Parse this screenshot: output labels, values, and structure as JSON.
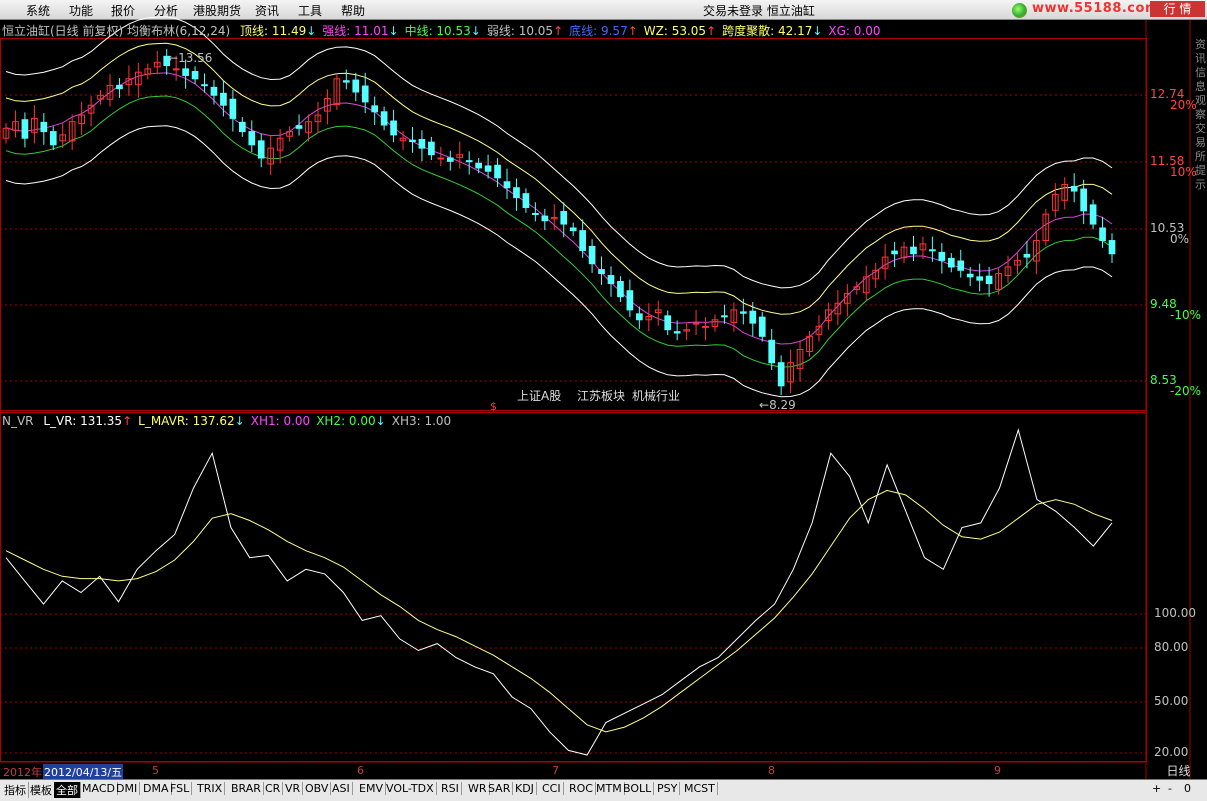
{
  "menu": {
    "items": [
      "系统",
      "功能",
      "报价",
      "分析",
      "港股期货",
      "资讯",
      "工具",
      "帮助"
    ],
    "status": "交易未登录",
    "stock": "恒立油缸",
    "url": "www.55188.com",
    "quote_btn": "行 情"
  },
  "main_info": {
    "title": "恒立油缸(日线 前复权) 均衡布林(6,12,24)",
    "items": [
      {
        "label": "顶线: 11.49",
        "arrow": "↓",
        "color": "#ffff66"
      },
      {
        "label": "强线: 11.01",
        "arrow": "↓",
        "color": "#ff44ff"
      },
      {
        "label": "中线: 10.53",
        "arrow": "↓",
        "color": "#44ff44"
      },
      {
        "label": "弱线: 10.05",
        "arrow": "↑",
        "color": "#c0c0c0"
      },
      {
        "label": "底线: 9.57",
        "arrow": "↑",
        "color": "#4466ff"
      },
      {
        "label": "WZ: 53.05",
        "arrow": "↑",
        "color": "#ffff66"
      },
      {
        "label": "跨度聚散: 42.17",
        "arrow": "↓",
        "color": "#ffff66"
      },
      {
        "label": "XG: 0.00",
        "arrow": "",
        "color": "#ff44ff"
      }
    ]
  },
  "price_axis": [
    {
      "price": "12.74",
      "pct": "20%"
    },
    {
      "price": "11.58",
      "pct": "10%"
    },
    {
      "price": "10.53",
      "pct": "0%"
    },
    {
      "price": "9.48",
      "pct": "-10%"
    },
    {
      "price": "8.53",
      "pct": "-20%"
    }
  ],
  "annotations": {
    "high": "13.56",
    "low": "8.29",
    "marker": "$"
  },
  "sectors": [
    "上证A股",
    "江苏板块",
    "机械行业"
  ],
  "sub_info": {
    "title": "N_VR",
    "items": [
      {
        "label": "L_VR: 131.35",
        "arrow": "↑",
        "color": "#ffffff"
      },
      {
        "label": "L_MAVR: 137.62",
        "arrow": "↓",
        "color": "#ffff66"
      },
      {
        "label": "XH1: 0.00",
        "arrow": "",
        "color": "#ff44ff"
      },
      {
        "label": "XH2: 0.00",
        "arrow": "↓",
        "color": "#44ff44"
      },
      {
        "label": "XH3: 1.00",
        "arrow": "",
        "color": "#c0c0c0"
      }
    ]
  },
  "sub_axis": [
    "100.00",
    "80.00",
    "50.00",
    "20.00"
  ],
  "dates": {
    "year": "2012年",
    "cursor": "2012/04/13/五",
    "months": [
      "5",
      "6",
      "7",
      "8",
      "9"
    ]
  },
  "daily_label": "日线",
  "tabs": [
    "指标",
    "模板",
    "全部",
    "MACD",
    "DMI",
    "DMA",
    "FSL",
    "TRIX",
    "BRAR",
    "CR",
    "VR",
    "OBV",
    "ASI",
    "EMV",
    "VOL-TDX",
    "RSI",
    "WR",
    "SAR",
    "KDJ",
    "CCI",
    "ROC",
    "MTM",
    "BOLL",
    "PSY",
    "MCST"
  ],
  "right_strip": "资讯信息观察交易所提示",
  "chart_data": [
    {
      "type": "candlestick",
      "title": "恒立油缸(日线 前复权) 均衡布林(6,12,24)",
      "ylim": [
        8.29,
        13.56
      ],
      "close": [
        12.45,
        12.55,
        12.3,
        12.6,
        12.4,
        12.2,
        12.35,
        12.55,
        12.65,
        12.8,
        12.95,
        13.1,
        13.05,
        13.2,
        13.3,
        13.35,
        13.45,
        13.4,
        13.35,
        13.25,
        13.2,
        13.1,
        12.95,
        12.8,
        12.6,
        12.4,
        12.2,
        12.0,
        12.15,
        12.3,
        12.4,
        12.45,
        12.55,
        12.65,
        12.9,
        13.2,
        13.15,
        13.0,
        12.85,
        12.7,
        12.5,
        12.35,
        12.3,
        12.25,
        12.15,
        12.05,
        12.0,
        11.95,
        12.05,
        11.95,
        11.85,
        11.8,
        11.7,
        11.55,
        11.4,
        11.25,
        11.15,
        11.05,
        11.1,
        11.0,
        10.9,
        10.6,
        10.4,
        10.25,
        10.1,
        9.9,
        9.7,
        9.55,
        9.6,
        9.7,
        9.4,
        9.35,
        9.4,
        9.5,
        9.45,
        9.55,
        9.6,
        9.7,
        9.65,
        9.5,
        9.3,
        8.9,
        8.55,
        8.9,
        9.1,
        9.3,
        9.45,
        9.7,
        9.8,
        9.95,
        10.05,
        10.2,
        10.3,
        10.5,
        10.55,
        10.65,
        10.55,
        10.7,
        10.6,
        10.45,
        10.35,
        10.3,
        10.2,
        10.15,
        10.1,
        10.25,
        10.35,
        10.45,
        10.5,
        10.75,
        11.15,
        11.45,
        11.6,
        11.5,
        11.2,
        11.0,
        10.75,
        10.55
      ],
      "series": [
        {
          "name": "顶线",
          "values": [
            12.95,
            12.8,
            11.49
          ]
        },
        {
          "name": "强线",
          "values": [
            12.55,
            12.4,
            11.01
          ]
        },
        {
          "name": "中线",
          "values": [
            12.2,
            12.05,
            10.53
          ]
        },
        {
          "name": "弱线",
          "values": [
            11.9,
            11.7,
            10.05
          ]
        },
        {
          "name": "底线",
          "values": [
            11.5,
            11.3,
            9.57
          ]
        }
      ]
    },
    {
      "type": "line",
      "title": "N_VR",
      "ylim": [
        20,
        160
      ],
      "series": [
        {
          "name": "L_VR",
          "values": [
            105,
            95,
            85,
            95,
            90,
            97,
            86,
            100,
            108,
            115,
            135,
            150,
            118,
            105,
            106,
            95,
            100,
            98,
            90,
            78,
            80,
            70,
            65,
            68,
            62,
            58,
            55,
            45,
            40,
            30,
            22,
            20,
            34,
            38,
            42,
            46,
            52,
            58,
            62,
            70,
            78,
            85,
            100,
            120,
            150,
            140,
            120,
            145,
            125,
            105,
            100,
            118,
            120,
            135,
            160,
            130,
            125,
            118,
            110,
            120
          ]
        },
        {
          "name": "L_MAVR",
          "values": [
            108,
            104,
            100,
            97,
            96,
            96,
            95,
            96,
            99,
            104,
            112,
            122,
            124,
            121,
            117,
            112,
            108,
            105,
            101,
            95,
            89,
            84,
            78,
            74,
            71,
            67,
            63,
            58,
            53,
            47,
            40,
            33,
            30,
            32,
            36,
            41,
            47,
            53,
            59,
            65,
            72,
            79,
            88,
            98,
            110,
            122,
            130,
            134,
            132,
            126,
            119,
            114,
            113,
            116,
            122,
            128,
            130,
            128,
            124,
            121
          ]
        }
      ]
    }
  ]
}
